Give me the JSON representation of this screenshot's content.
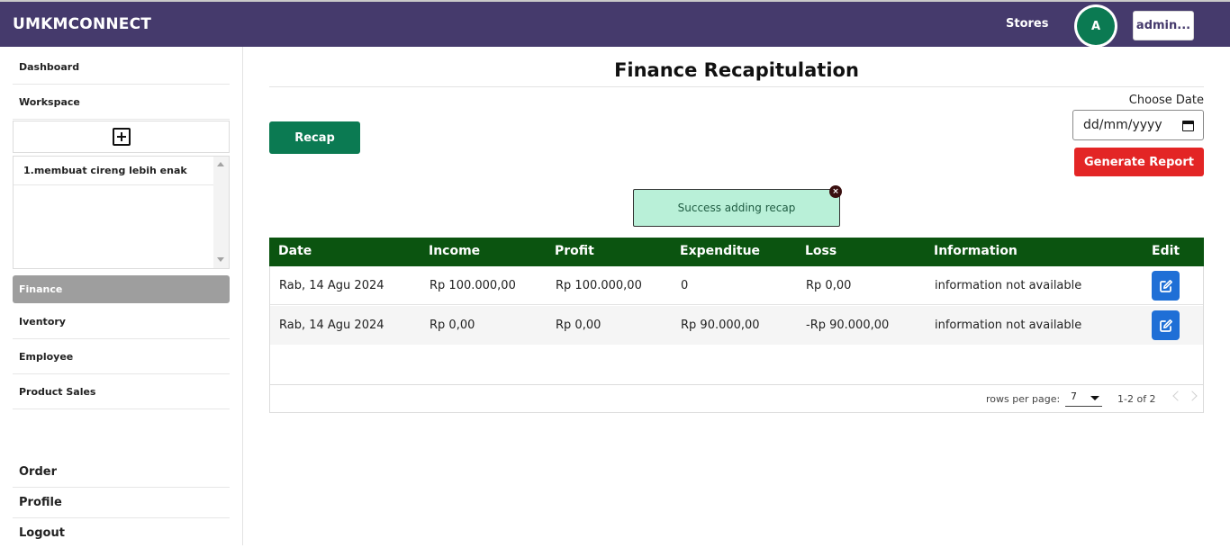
{
  "header": {
    "brand": "UMKMCONNECT",
    "stores_label": "Stores",
    "avatar_initial": "A",
    "admin_label": "admin..."
  },
  "sidebar": {
    "top_items": [
      "Dashboard",
      "Workspace"
    ],
    "workspace_items": [
      "1.membuat cireng lebih enak"
    ],
    "active_item": "Finance",
    "menu_items": [
      "Iventory",
      "Employee",
      "Product Sales"
    ],
    "bottom_items": [
      "Order",
      "Profile",
      "Logout"
    ]
  },
  "main": {
    "title": "Finance Recapitulation",
    "recap_button": "Recap",
    "choose_date_label": "Choose Date",
    "date_placeholder": "dd/mm/yyyy",
    "generate_report_button": "Generate Report",
    "alert_message": "Success adding recap",
    "alert_close": "×"
  },
  "table": {
    "columns": [
      "Date",
      "Income",
      "Profit",
      "Expenditue",
      "Loss",
      "Information",
      "Edit"
    ],
    "rows": [
      [
        "Rab, 14 Agu 2024",
        "Rp 100.000,00",
        "Rp 100.000,00",
        "0",
        "Rp 0,00",
        "information not available"
      ],
      [
        "Rab, 14 Agu 2024",
        "Rp 0,00",
        "Rp 0,00",
        "Rp 90.000,00",
        "-Rp 90.000,00",
        "information not available"
      ]
    ],
    "rows_per_page_label": "rows per page:",
    "rows_per_page_value": "7",
    "range_text": "1-2 of 2"
  },
  "colors": {
    "header_bg": "#453a6c",
    "primary_green": "#0b7a52",
    "table_header": "#0b5410",
    "danger": "#e32525",
    "edit_blue": "#1f6fd6",
    "alert_bg": "#b9f0d8",
    "active_sidebar": "#9e9e9e"
  }
}
